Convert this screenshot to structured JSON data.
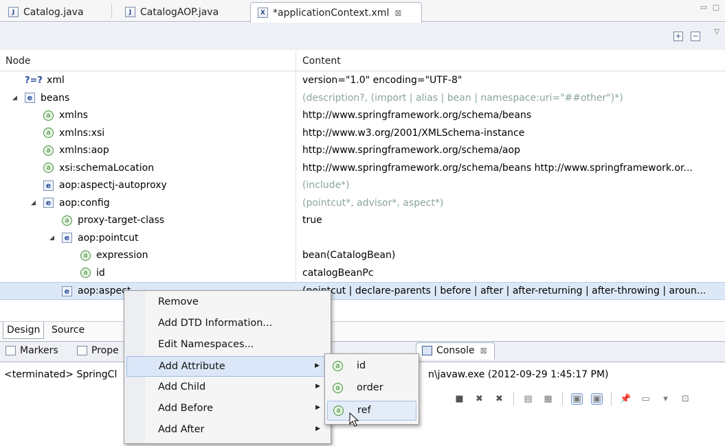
{
  "editor_tabs": [
    {
      "label": "Catalog.java",
      "icon": "java-file-icon",
      "glyph": "J",
      "closable": false
    },
    {
      "label": "CatalogAOP.java",
      "icon": "java-file-icon",
      "glyph": "J",
      "closable": false
    },
    {
      "label": "*applicationContext.xml",
      "icon": "xml-file-icon",
      "glyph": "X",
      "closable": true,
      "close_glyph": "⊠"
    }
  ],
  "window_controls": "▭ ▢",
  "editor_toolbar": {
    "expand_glyph": "+",
    "collapse_glyph": "−",
    "menu_glyph": "▽"
  },
  "tree": {
    "headers": {
      "node": "Node",
      "content": "Content"
    },
    "rows": [
      {
        "node": "xml",
        "icon": "pi",
        "icon_glyph": "?=?",
        "level": 0,
        "twisty": "",
        "content": "version=\"1.0\" encoding=\"UTF-8\"",
        "hint": false
      },
      {
        "node": "beans",
        "icon": "e",
        "icon_glyph": "e",
        "level": 0,
        "twisty": "◢",
        "content": "(description?, (import | alias | bean | namespace:uri=\"##other\")*)",
        "hint": true
      },
      {
        "node": "xmlns",
        "icon": "a",
        "icon_glyph": "a",
        "level": 1,
        "twisty": "",
        "content": "http://www.springframework.org/schema/beans",
        "hint": false
      },
      {
        "node": "xmlns:xsi",
        "icon": "a",
        "icon_glyph": "a",
        "level": 1,
        "twisty": "",
        "content": "http://www.w3.org/2001/XMLSchema-instance",
        "hint": false
      },
      {
        "node": "xmlns:aop",
        "icon": "a",
        "icon_glyph": "a",
        "level": 1,
        "twisty": "",
        "content": "http://www.springframework.org/schema/aop",
        "hint": false
      },
      {
        "node": "xsi:schemaLocation",
        "icon": "a",
        "icon_glyph": "a",
        "level": 1,
        "twisty": "",
        "content": "http://www.springframework.org/schema/beans http://www.springframework.or...",
        "hint": false
      },
      {
        "node": "aop:aspectj-autoproxy",
        "icon": "e",
        "icon_glyph": "e",
        "level": 1,
        "twisty": "",
        "content": "(include*)",
        "hint": true
      },
      {
        "node": "aop:config",
        "icon": "e",
        "icon_glyph": "e",
        "level": 1,
        "twisty": "◢",
        "content": "(pointcut*, advisor*, aspect*)",
        "hint": true
      },
      {
        "node": "proxy-target-class",
        "icon": "a",
        "icon_glyph": "a",
        "level": 2,
        "twisty": "",
        "content": "true",
        "hint": false
      },
      {
        "node": "aop:pointcut",
        "icon": "e",
        "icon_glyph": "e",
        "level": 2,
        "twisty": "◢",
        "content": "",
        "hint": false
      },
      {
        "node": "expression",
        "icon": "a",
        "icon_glyph": "a",
        "level": 3,
        "twisty": "",
        "content": "bean(CatalogBean)",
        "hint": false
      },
      {
        "node": "id",
        "icon": "a",
        "icon_glyph": "a",
        "level": 3,
        "twisty": "",
        "content": "catalogBeanPc",
        "hint": false
      },
      {
        "node": "aop:aspect",
        "icon": "e",
        "icon_glyph": "e",
        "level": 2,
        "twisty": "",
        "content": "(pointcut | declare-parents | before | after | after-returning | after-throwing | aroun...",
        "hint": false,
        "selected": true
      }
    ]
  },
  "design_source_tabs": {
    "design": "Design",
    "source": "Source"
  },
  "views": {
    "tabs": [
      {
        "label": "Markers"
      },
      {
        "label": "Prope"
      },
      {
        "label": "Console",
        "close_glyph": "⊠"
      }
    ],
    "console_prefix": "<terminated> SpringCl",
    "console_suffix": "n\\javaw.exe (2012-09-29 1:45:17 PM)"
  },
  "console_toolbar": [
    {
      "name": "terminate-icon",
      "glyph": "■",
      "pressed": false
    },
    {
      "name": "remove-launch-icon",
      "glyph": "✖",
      "pressed": false
    },
    {
      "name": "remove-all-icon",
      "glyph": "✖",
      "pressed": false
    },
    {
      "name": "clear-console-icon",
      "glyph": "▤",
      "pressed": false
    },
    {
      "name": "scroll-lock-icon",
      "glyph": "▦",
      "pressed": false
    },
    {
      "name": "show-on-stdout-icon",
      "glyph": "▣",
      "pressed": true
    },
    {
      "name": "show-on-stderr-icon",
      "glyph": "▣",
      "pressed": true
    },
    {
      "name": "pin-console-icon",
      "glyph": "📌",
      "pressed": false
    },
    {
      "name": "display-console-icon",
      "glyph": "▭",
      "pressed": false
    },
    {
      "name": "dropdown-icon",
      "glyph": "▾",
      "pressed": false
    },
    {
      "name": "new-console-icon",
      "glyph": "⊡",
      "pressed": false
    }
  ],
  "context_menu": [
    {
      "label": "Remove",
      "submenu": false
    },
    {
      "label": "Add DTD Information...",
      "submenu": false
    },
    {
      "label": "Edit Namespaces...",
      "submenu": false
    },
    {
      "label": "Add Attribute",
      "submenu": true,
      "highlight": true
    },
    {
      "label": "Add Child",
      "submenu": true
    },
    {
      "label": "Add Before",
      "submenu": true
    },
    {
      "label": "Add After",
      "submenu": true
    }
  ],
  "submenu_arrow": "▶",
  "attribute_submenu": [
    {
      "label": "id",
      "icon_glyph": "a"
    },
    {
      "label": "order",
      "icon_glyph": "a"
    },
    {
      "label": "ref",
      "icon_glyph": "a",
      "highlight": true
    }
  ]
}
